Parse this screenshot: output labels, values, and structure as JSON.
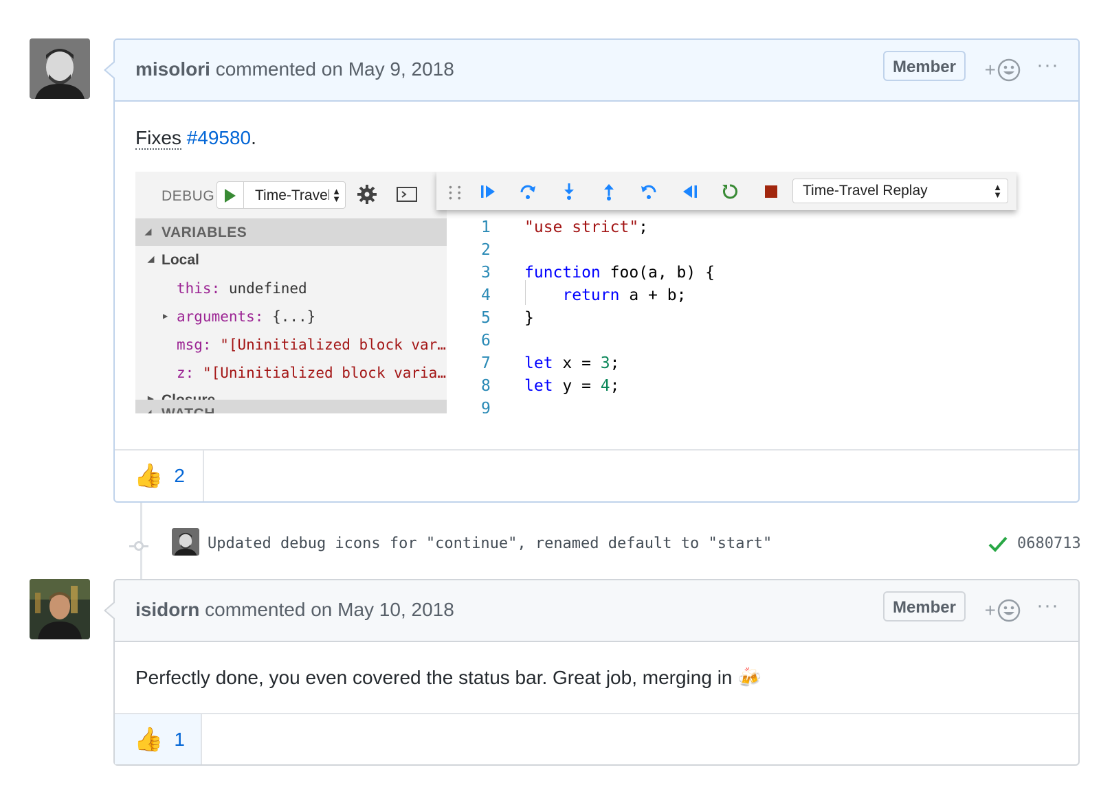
{
  "comment1": {
    "author": "misolori",
    "meta": "commented on May 9, 2018",
    "badge": "Member",
    "add_reaction": "+",
    "more": "···",
    "body_prefix": "Fixes",
    "issue_link": "#49580",
    "body_suffix": ".",
    "reaction": {
      "emoji": "👍",
      "count": "2"
    }
  },
  "debug_panel": {
    "label": "DEBUG",
    "config_select": "Time-Travel",
    "sections": {
      "variables": "VARIABLES",
      "watch": "WATCH",
      "closure": "Closure"
    },
    "scope": "Local",
    "variables": [
      {
        "name": "this:",
        "value": "undefined"
      },
      {
        "name": "arguments:",
        "value": "{...}"
      },
      {
        "name": "msg:",
        "value": "\"[Uninitialized block var…"
      },
      {
        "name": "z:",
        "value": "\"[Uninitialized block varia…"
      }
    ],
    "toolbar_select": "Time-Travel Replay"
  },
  "code_lines": [
    {
      "n": "1"
    },
    {
      "n": "2"
    },
    {
      "n": "3"
    },
    {
      "n": "4"
    },
    {
      "n": "5"
    },
    {
      "n": "6"
    },
    {
      "n": "7"
    },
    {
      "n": "8"
    },
    {
      "n": "9"
    }
  ],
  "commit": {
    "message": "Updated debug icons for \"continue\", renamed default to \"start\"",
    "sha": "0680713"
  },
  "comment2": {
    "author": "isidorn",
    "meta": "commented on May 10, 2018",
    "badge": "Member",
    "add_reaction": "+",
    "more": "···",
    "body": "Perfectly done, you even covered the status bar. Great job, merging in",
    "body_emoji": "🍻",
    "reaction": {
      "emoji": "👍",
      "count": "1"
    }
  },
  "icons": [
    "avatar",
    "smiley-icon",
    "kebab-icon",
    "play-icon",
    "gear-icon",
    "terminal-icon",
    "continue-icon",
    "step-over-icon",
    "step-into-icon",
    "step-out-icon",
    "step-back-icon",
    "reverse-continue-icon",
    "restart-icon",
    "stop-icon",
    "check-icon"
  ],
  "colors": {
    "link": "#0366d6",
    "keyword": "#0000ff",
    "string": "#a31515",
    "number": "#098658",
    "debug_blue": "#1a85ff",
    "debug_green": "#388a34",
    "stop_red": "#a1260d"
  }
}
